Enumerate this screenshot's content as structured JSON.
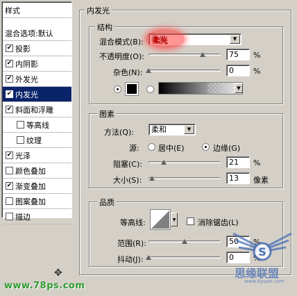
{
  "left_panel": {
    "header_styles": "样式",
    "header_blend": "混合选项:默认",
    "items": [
      {
        "label": "投影",
        "checked": true
      },
      {
        "label": "内阴影",
        "checked": true
      },
      {
        "label": "外发光",
        "checked": true
      },
      {
        "label": "内发光",
        "checked": true,
        "selected": true
      },
      {
        "label": "斜面和浮雕",
        "checked": true
      },
      {
        "label": "等高线",
        "checked": false,
        "sub": true
      },
      {
        "label": "纹理",
        "checked": false,
        "sub": true
      },
      {
        "label": "光泽",
        "checked": true
      },
      {
        "label": "颜色叠加",
        "checked": false
      },
      {
        "label": "渐变叠加",
        "checked": true
      },
      {
        "label": "图案叠加",
        "checked": false
      },
      {
        "label": "描边",
        "checked": false
      }
    ]
  },
  "panel_title": "内发光",
  "structure": {
    "title": "结构",
    "blend_mode_label": "混合模式(B):",
    "blend_mode_value": "柔光",
    "opacity_label": "不透明度(O):",
    "opacity_value": "75",
    "opacity_unit": "%",
    "opacity_level": 0.75,
    "noise_label": "杂色(N):",
    "noise_value": "0",
    "noise_unit": "%",
    "noise_level": 0.0,
    "color_swatch": "#000000"
  },
  "elements": {
    "title": "图素",
    "method_label": "方法(Q):",
    "method_value": "柔和",
    "source_label": "源:",
    "source_center": "居中(E)",
    "source_edge": "边缘(G)",
    "choke_label": "阻塞(C):",
    "choke_value": "21",
    "choke_unit": "%",
    "choke_level": 0.21,
    "size_label": "大小(S):",
    "size_value": "13",
    "size_unit": "像素",
    "size_level": 0.05
  },
  "quality": {
    "title": "品质",
    "contour_label": "等高线:",
    "antialias_label": "消除锯齿(L)",
    "range_label": "范围(R):",
    "range_value": "50",
    "range_unit": "%",
    "range_level": 0.5,
    "jitter_label": "抖动(J):",
    "jitter_value": "0",
    "jitter_unit": "%",
    "jitter_level": 0.0
  },
  "watermarks": {
    "left": "www.78ps.com",
    "right_main": "思缘联盟",
    "right_sub": "www.8yuan.com"
  },
  "colors": {
    "highlight": "#ff3b3b",
    "selected_bg": "#0a246a",
    "watermark_green": "#2e9a2e",
    "watermark_blue": "#4a6fb5"
  }
}
